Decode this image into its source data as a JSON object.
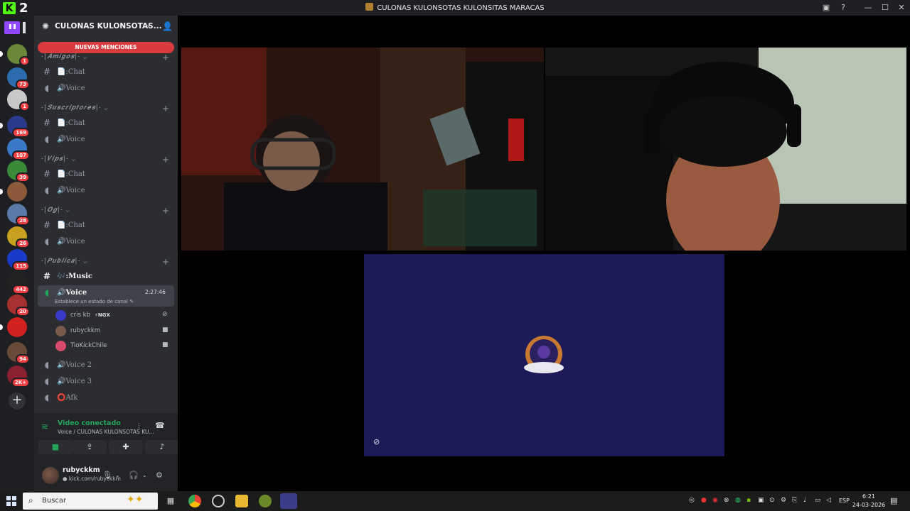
{
  "window": {
    "title": "CULONAS KULONSOTAS KULONSITAS MARACAS",
    "app_count": "2",
    "app_logo": "K",
    "controls": [
      "inbox-icon",
      "help-icon",
      "minimize-icon",
      "maximize-icon",
      "close-icon"
    ]
  },
  "servers": [
    {
      "badge": "1",
      "color": "#6a8a3a"
    },
    {
      "badge": "73",
      "color": "#2d6bb0"
    },
    {
      "badge": "1",
      "color": "#c8c8c8"
    },
    {
      "badge": "169",
      "color": "#2b3a8a"
    },
    {
      "badge": "107",
      "color": "#3a78c8"
    },
    {
      "badge": "39",
      "color": "#3a8a3a"
    },
    {
      "badge": "",
      "color": "#8a5a3a"
    },
    {
      "badge": "28",
      "color": "#5a7aa8"
    },
    {
      "badge": "26",
      "color": "#c8a020"
    },
    {
      "badge": "115",
      "color": "#1a3ac8"
    },
    {
      "badge": "442",
      "color": "#222222"
    },
    {
      "badge": "20",
      "color": "#a83030"
    },
    {
      "badge": "",
      "color": "#d02020"
    },
    {
      "badge": "94",
      "color": "#6a4a3a"
    },
    {
      "badge": "2K+",
      "color": "#8a2030"
    }
  ],
  "sidebar": {
    "server_name": "CULONAS KULONSOTAS...",
    "mentions": "NUEVAS MENCIONES",
    "categories": [
      {
        "name": "-|𝑨𝒎𝒊𝒈𝒐𝒔|-",
        "chat": "📄:Chat",
        "voice": "🔊Voice"
      },
      {
        "name": "-|𝑺𝒖𝒔𝒄𝒓𝒊𝒑𝒕𝒐𝒓𝒆𝒔|-",
        "chat": "📄:Chat",
        "voice": "🔊Voice"
      },
      {
        "name": "-|𝑽𝒊𝒑𝒔|-",
        "chat": "📄:Chat",
        "voice": "🔊Voice"
      },
      {
        "name": "-|𝑶𝒈|-",
        "chat": "📄:Chat",
        "voice": "🔊Voice"
      }
    ],
    "public_category": "-|𝑷𝒖𝒃𝒍𝒊𝒄𝒂|-",
    "music_channel": "🎶:Music",
    "voice_channel": "🔊Voice",
    "voice_timer": "2:27:46",
    "voice_status": "Establece un estado de canal ✎",
    "voice_users": [
      {
        "name": "cris kb",
        "tag": "⚡NGX",
        "color": "#3a3ac8"
      },
      {
        "name": "rubyckkm",
        "tag": "",
        "color": "#7a5a4a"
      },
      {
        "name": "TioKickChile",
        "tag": "",
        "color": "#d84a6a"
      }
    ],
    "voice2": "🔊Voice 2",
    "voice3": "🔊Voice 3",
    "afk": "⭕Afk"
  },
  "voice_panel": {
    "title": "Video conectado",
    "subtitle": "Voice / CULONAS KULONSOTAS KU..."
  },
  "user_panel": {
    "name": "rubyckkm",
    "status": "● kick.com/rubyckkm"
  },
  "taskbar": {
    "search_placeholder": "Buscar",
    "lang": "ESP",
    "time": "6:21",
    "date": "24-03-2026"
  }
}
